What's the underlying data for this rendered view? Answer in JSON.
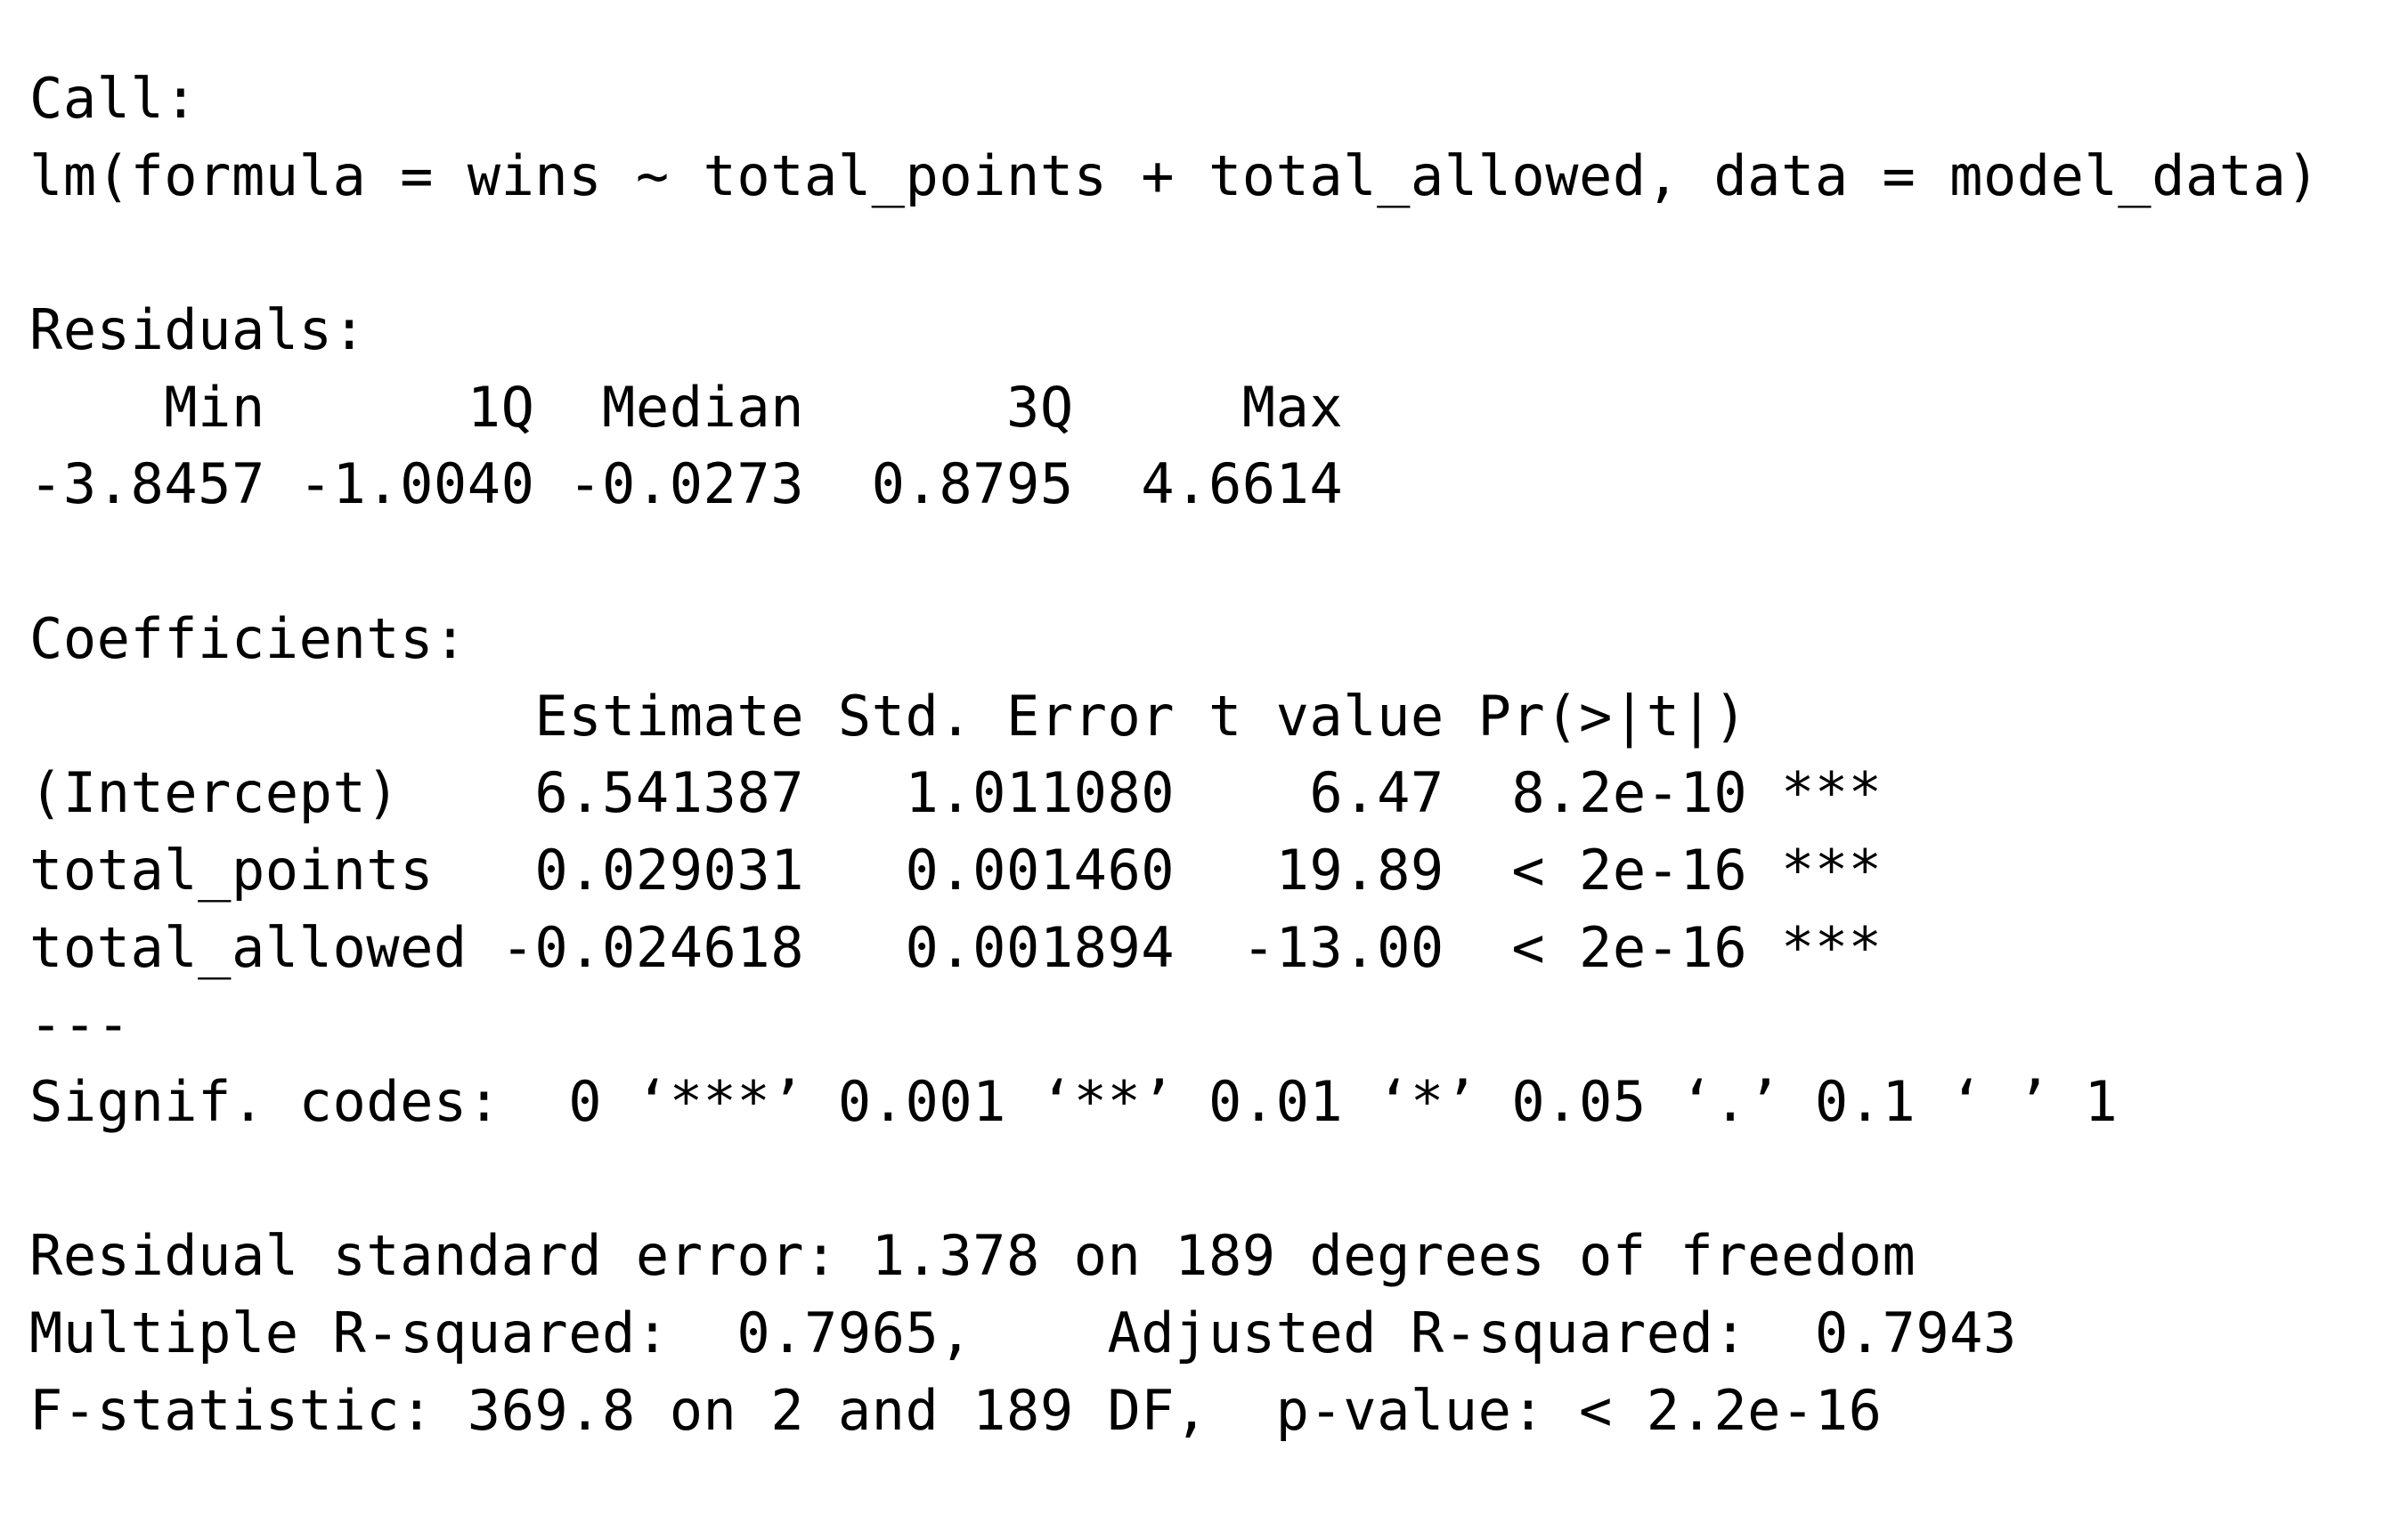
{
  "console_lines": [
    "Call:",
    "lm(formula = wins ~ total_points + total_allowed, data = model_data)",
    "",
    "Residuals:",
    "    Min      1Q  Median      3Q     Max ",
    "-3.8457 -1.0040 -0.0273  0.8795  4.6614 ",
    "",
    "Coefficients:",
    "               Estimate Std. Error t value Pr(>|t|)    ",
    "(Intercept)    6.541387   1.011080    6.47  8.2e-10 ***",
    "total_points   0.029031   0.001460   19.89  < 2e-16 ***",
    "total_allowed -0.024618   0.001894  -13.00  < 2e-16 ***",
    "---",
    "Signif. codes:  0 ‘***’ 0.001 ‘**’ 0.01 ‘*’ 0.05 ‘.’ 0.1 ‘ ’ 1",
    "",
    "Residual standard error: 1.378 on 189 degrees of freedom",
    "Multiple R-squared:  0.7965,\tAdjusted R-squared:  0.7943 ",
    "F-statistic: 369.8 on 2 and 189 DF,  p-value: < 2.2e-16"
  ]
}
